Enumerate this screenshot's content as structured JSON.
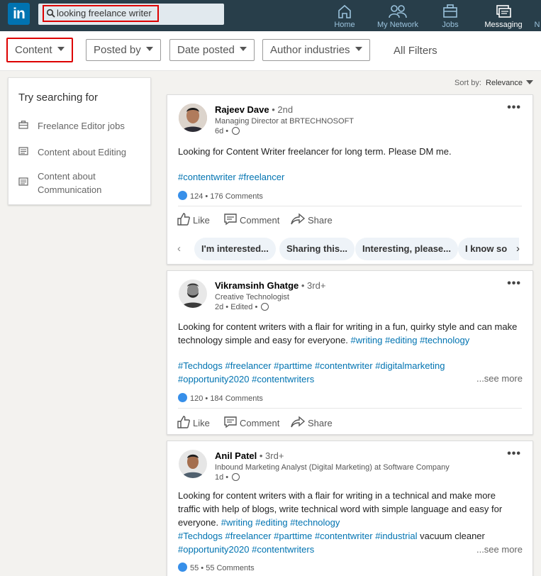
{
  "nav": {
    "logo": "in",
    "search_value": "looking freelance writer",
    "items": [
      {
        "label": "Home",
        "icon": "home-icon"
      },
      {
        "label": "My Network",
        "icon": "network-icon"
      },
      {
        "label": "Jobs",
        "icon": "briefcase-icon"
      },
      {
        "label": "Messaging",
        "icon": "messaging-icon"
      },
      {
        "label": "N",
        "icon": "notifications-icon"
      }
    ],
    "colors": {
      "bar": "#283e4a",
      "accent": "#0073b1"
    }
  },
  "filters": {
    "buttons": [
      "Content",
      "Posted by",
      "Date posted",
      "Author industries"
    ],
    "all_filters": "All Filters"
  },
  "sidebar": {
    "title": "Try searching for",
    "items": [
      {
        "label": "Freelance Editor jobs",
        "icon": "briefcase-icon"
      },
      {
        "label": "Content about Editing",
        "icon": "document-icon"
      },
      {
        "label": "Content about Communication",
        "icon": "document-icon"
      }
    ]
  },
  "sort": {
    "label": "Sort by:",
    "value": "Relevance"
  },
  "posts": [
    {
      "name": "Rajeev Dave",
      "degree": "• 2nd",
      "title": "Managing Director at BRTECHNOSOFT",
      "time": "6d •",
      "text": "Looking for Content Writer freelancer for long term. Please DM me.",
      "tags": "#contentwriter #freelancer",
      "reactions": "124 • 176 Comments",
      "actions": [
        "Like",
        "Comment",
        "Share"
      ],
      "chips": [
        "I'm interested...",
        "Sharing this...",
        "Interesting, please...",
        "I know so"
      ]
    },
    {
      "name": "Vikramsinh Ghatge",
      "degree": "• 3rd+",
      "title": "Creative Technologist",
      "time": "2d • Edited •",
      "text_plain": "Looking for content writers with a flair for writing in a fun, quirky style and can make technology simple and easy for everyone.",
      "text_tags": "#writing #editing #technology",
      "tags_line1": "#Techdogs #freelancer #parttime #contentwriter #digitalmarketing",
      "tags_line2": "#opportunity2020 #contentwriters",
      "see_more": "...see more",
      "reactions": "120 • 184 Comments",
      "actions": [
        "Like",
        "Comment",
        "Share"
      ]
    },
    {
      "name": "Anil Patel",
      "degree": "• 3rd+",
      "title": "Inbound Marketing Analyst (Digital Marketing) at Software Company",
      "time": "1d •",
      "text_l1": "Looking for content writers with a flair for writing in a technical and make more",
      "text_l2": "traffic with help of blogs, write technical word with simple language and easy for",
      "text_l3_plain": "everyone.",
      "text_l3_tags": "#writing #editing #technology",
      "tags_l4": "#Techdogs #freelancer #parttime #contentwriter #industrial",
      "tags_l4_plain": "vacuum cleaner",
      "tags_l5": "#opportunity2020 #contentwriters",
      "see_more": "...see more",
      "reactions": "55 • 55 Comments"
    }
  ]
}
